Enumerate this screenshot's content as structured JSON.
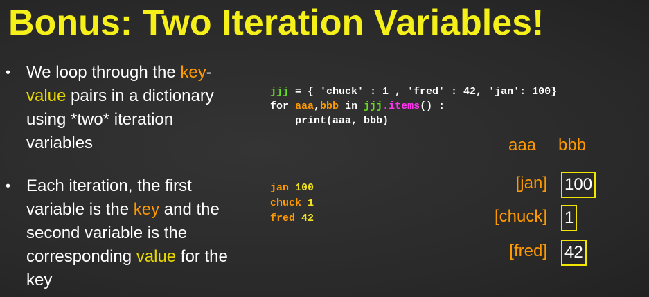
{
  "title": "Bonus: Two Iteration Variables!",
  "bullets": [
    {
      "parts": [
        {
          "text": "We loop through the ",
          "style": "plain"
        },
        {
          "text": "key",
          "style": "orange"
        },
        {
          "text": "-",
          "style": "plain"
        },
        {
          "text": "value",
          "style": "yellow"
        },
        {
          "text": " pairs in a dictionary using *two* iteration variables",
          "style": "plain"
        }
      ]
    },
    {
      "parts": [
        {
          "text": "Each iteration, the first variable is the ",
          "style": "plain"
        },
        {
          "text": "key",
          "style": "orange"
        },
        {
          "text": " and the second variable is the corresponding ",
          "style": "plain"
        },
        {
          "text": "value",
          "style": "yellow"
        },
        {
          "text": " for the key",
          "style": "plain"
        }
      ]
    }
  ],
  "code": {
    "line1": [
      {
        "text": "jjj",
        "style": "green"
      },
      {
        "text": " = { 'chuck' : 1 , 'fred' : 42, 'jan': 100}",
        "style": "plain"
      }
    ],
    "line2": [
      {
        "text": "for ",
        "style": "plain"
      },
      {
        "text": "aaa",
        "style": "orange"
      },
      {
        "text": ",",
        "style": "plain"
      },
      {
        "text": "bbb",
        "style": "orange"
      },
      {
        "text": " in ",
        "style": "plain"
      },
      {
        "text": "jjj",
        "style": "green"
      },
      {
        "text": ".items",
        "style": "magenta"
      },
      {
        "text": "() :",
        "style": "plain"
      }
    ],
    "line3": [
      {
        "text": "    print(aaa, bbb)",
        "style": "plain"
      }
    ]
  },
  "output": [
    {
      "key": "jan",
      "value": "100"
    },
    {
      "key": "chuck",
      "value": "1"
    },
    {
      "key": "fred",
      "value": "42"
    }
  ],
  "diagram": {
    "header_key": "aaa",
    "header_value": "bbb",
    "rows": [
      {
        "key": "[jan]",
        "value": "100"
      },
      {
        "key": "[chuck]",
        "value": "1"
      },
      {
        "key": "[fred]",
        "value": "42"
      }
    ]
  },
  "colors": {
    "title": "#f5ef1a",
    "key": "#ff9900",
    "value": "#e8d800",
    "code_var": "#66dd22",
    "code_method": "#ff33ee",
    "background": "#2b2b2b"
  }
}
